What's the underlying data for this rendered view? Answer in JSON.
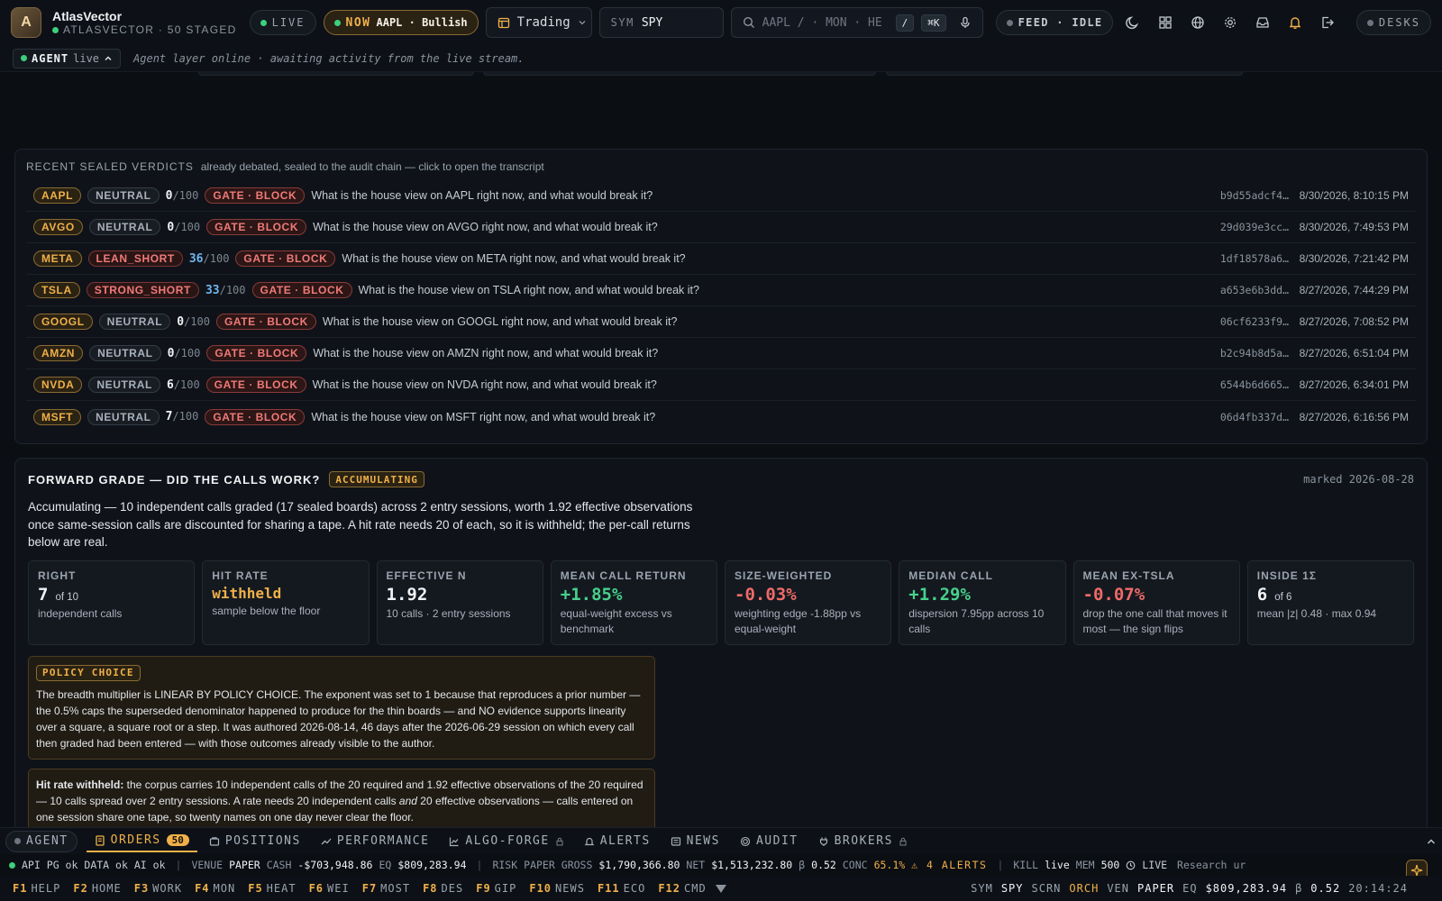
{
  "topbar": {
    "logo_letter": "A",
    "brand_name": "AtlasVector",
    "brand_sub": "ATLASVECTOR · 50 STAGED",
    "live_label": "LIVE",
    "now_label": "NOW",
    "now_text": "AAPL · Bullish",
    "mode_select": "Trading",
    "sym_label": "SYM",
    "sym_value": "SPY",
    "search_placeholder": "AAPL / · MON · HE",
    "kbd_slash": "/",
    "kbd_cmd": "⌘K",
    "feed_label": "FEED · IDLE",
    "desks_label": "DESKS"
  },
  "agentbar": {
    "label": "AGENT",
    "state": "live",
    "message": "Agent layer online · awaiting activity from the live stream."
  },
  "verdicts": {
    "title": "RECENT SEALED VERDICTS",
    "subtitle": "already debated, sealed to the audit chain — click to open the transcript",
    "score_max": "/100",
    "rows": [
      {
        "ticker": "AAPL",
        "stance": "NEUTRAL",
        "score": "0",
        "gate": "GATE · BLOCK",
        "question": "What is the house view on AAPL right now, and what would break it?",
        "hash": "b9d55adcf4…",
        "time": "8/30/2026, 8:10:15 PM"
      },
      {
        "ticker": "AVGO",
        "stance": "NEUTRAL",
        "score": "0",
        "gate": "GATE · BLOCK",
        "question": "What is the house view on AVGO right now, and what would break it?",
        "hash": "29d039e3cc…",
        "time": "8/30/2026, 7:49:53 PM"
      },
      {
        "ticker": "META",
        "stance": "LEAN_SHORT",
        "score": "36",
        "gate": "GATE · BLOCK",
        "question": "What is the house view on META right now, and what would break it?",
        "hash": "1df18578a6…",
        "time": "8/30/2026, 7:21:42 PM"
      },
      {
        "ticker": "TSLA",
        "stance": "STRONG_SHORT",
        "score": "33",
        "gate": "GATE · BLOCK",
        "question": "What is the house view on TSLA right now, and what would break it?",
        "hash": "a653e6b3dd…",
        "time": "8/27/2026, 7:44:29 PM"
      },
      {
        "ticker": "GOOGL",
        "stance": "NEUTRAL",
        "score": "0",
        "gate": "GATE · BLOCK",
        "question": "What is the house view on GOOGL right now, and what would break it?",
        "hash": "06cf6233f9…",
        "time": "8/27/2026, 7:08:52 PM"
      },
      {
        "ticker": "AMZN",
        "stance": "NEUTRAL",
        "score": "0",
        "gate": "GATE · BLOCK",
        "question": "What is the house view on AMZN right now, and what would break it?",
        "hash": "b2c94b8d5a…",
        "time": "8/27/2026, 6:51:04 PM"
      },
      {
        "ticker": "NVDA",
        "stance": "NEUTRAL",
        "score": "6",
        "gate": "GATE · BLOCK",
        "question": "What is the house view on NVDA right now, and what would break it?",
        "hash": "6544b6d665…",
        "time": "8/27/2026, 6:34:01 PM"
      },
      {
        "ticker": "MSFT",
        "stance": "NEUTRAL",
        "score": "7",
        "gate": "GATE · BLOCK",
        "question": "What is the house view on MSFT right now, and what would break it?",
        "hash": "06d4fb337d…",
        "time": "8/27/2026, 6:16:56 PM"
      }
    ]
  },
  "grade": {
    "title": "FORWARD GRADE — DID THE CALLS WORK?",
    "badge": "ACCUMULATING",
    "marked": "marked 2026-08-28",
    "description": "Accumulating — 10 independent calls graded (17 sealed boards) across 2 entry sessions, worth 1.92 effective observations once same-session calls are discounted for sharing a tape. A hit rate needs 20 of each, so it is withheld; the per-call returns below are real.",
    "cards": [
      {
        "label": "RIGHT",
        "value": "7",
        "value_suffix": "of 10",
        "sub": "independent calls",
        "tone": "plain"
      },
      {
        "label": "HIT RATE",
        "value": "withheld",
        "value_suffix": "",
        "sub": "sample below the floor",
        "tone": "amber"
      },
      {
        "label": "EFFECTIVE N",
        "value": "1.92",
        "value_suffix": "",
        "sub": "10 calls · 2 entry sessions",
        "tone": "plain"
      },
      {
        "label": "MEAN CALL RETURN",
        "value": "+1.85%",
        "value_suffix": "",
        "sub": "equal-weight excess vs benchmark",
        "tone": "pos"
      },
      {
        "label": "SIZE-WEIGHTED",
        "value": "-0.03%",
        "value_suffix": "",
        "sub": "weighting edge -1.88pp vs equal-weight",
        "tone": "neg"
      },
      {
        "label": "MEDIAN CALL",
        "value": "+1.29%",
        "value_suffix": "",
        "sub": "dispersion 7.95pp across 10 calls",
        "tone": "pos"
      },
      {
        "label": "MEAN EX-TSLA",
        "value": "-0.07%",
        "value_suffix": "",
        "sub": "drop the one call that moves it most — the sign flips",
        "tone": "neg"
      },
      {
        "label": "INSIDE 1Σ",
        "value": "6",
        "value_suffix": "of 6",
        "sub": "mean |z| 0.48 · max 0.94",
        "tone": "plain"
      }
    ],
    "policy_tag": "POLICY CHOICE",
    "policy_text": "The breadth multiplier is LINEAR BY POLICY CHOICE. The exponent was set to 1 because that reproduces a prior number — the 0.5% caps the superseded denominator happened to produce for the thin boards — and NO evidence supports linearity over a square, a square root or a step. It was authored 2026-08-14, 46 days after the 2026-06-29 session on which every call then graded had been entered — with those outcomes already visible to the author.",
    "hitrate_bold": "Hit rate withheld:",
    "hitrate_text_a": " the corpus carries 10 independent calls of the 20 required and 1.92 effective observations of the 20 required — 10 calls spread over 2 entry sessions. A rate needs 20 independent calls ",
    "hitrate_em": "and",
    "hitrate_text_b": " 20 effective observations — calls entered on one session share one tape, so twenty names on one day never clear the floor."
  },
  "dock": {
    "agent": "AGENT",
    "orders": "ORDERS",
    "orders_count": "50",
    "positions": "POSITIONS",
    "performance": "PERFORMANCE",
    "algo_forge": "ALGO-FORGE",
    "alerts": "ALERTS",
    "news": "NEWS",
    "audit": "AUDIT",
    "brokers": "BROKERS"
  },
  "status": {
    "api": "API",
    "pg": "PG ok",
    "data": "DATA ok",
    "ai": "AI ok",
    "venue_k": "VENUE",
    "venue_v": "PAPER",
    "cash_k": "CASH",
    "cash_v": "-$703,948.86",
    "eq_k": "EQ",
    "eq_v": "$809,283.94",
    "risk_k": "RISK",
    "risk_v": "PAPER",
    "gross_k": "GROSS",
    "gross_v": "$1,790,366.80",
    "net_k": "NET",
    "net_v": "$1,513,232.80",
    "beta_k": "β",
    "beta_v": "0.52",
    "conc_k": "CONC",
    "conc_v": "65.1%",
    "alerts": "⚠ 4 ALERTS",
    "kill_k": "KILL",
    "kill_v": "live",
    "mem_k": "MEM",
    "mem_v": "500",
    "live": "LIVE",
    "research": "Research",
    "trailing": "ur"
  },
  "fkeys": {
    "items": [
      {
        "key": "F1",
        "label": "HELP"
      },
      {
        "key": "F2",
        "label": "HOME"
      },
      {
        "key": "F3",
        "label": "WORK"
      },
      {
        "key": "F4",
        "label": "MON"
      },
      {
        "key": "F5",
        "label": "HEAT"
      },
      {
        "key": "F6",
        "label": "WEI"
      },
      {
        "key": "F7",
        "label": "MOST"
      },
      {
        "key": "F8",
        "label": "DES"
      },
      {
        "key": "F9",
        "label": "GIP"
      },
      {
        "key": "F10",
        "label": "NEWS"
      },
      {
        "key": "F11",
        "label": "ECO"
      },
      {
        "key": "F12",
        "label": "CMD"
      }
    ],
    "right": {
      "sym_k": "SYM",
      "sym_v": "SPY",
      "scrn_k": "SCRN",
      "orch": "ORCH",
      "ven_k": "VEN",
      "ven_v": "PAPER",
      "eq_k": "EQ",
      "eq_v": "$809,283.94",
      "beta_k": "β",
      "beta_v": "0.52",
      "clock": "20:14:24"
    }
  }
}
